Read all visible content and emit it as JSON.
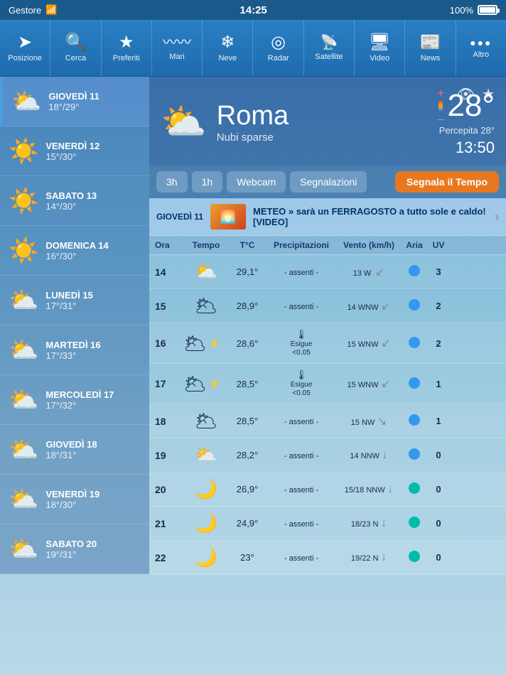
{
  "statusBar": {
    "carrier": "Gestore",
    "wifi": "📶",
    "time": "14:25",
    "battery": "100%"
  },
  "nav": {
    "items": [
      {
        "id": "posizione",
        "label": "Posizione",
        "icon": "➤"
      },
      {
        "id": "cerca",
        "label": "Cerca",
        "icon": "🔍"
      },
      {
        "id": "preferiti",
        "label": "Preferiti",
        "icon": "★"
      },
      {
        "id": "mari",
        "label": "Mari",
        "icon": "〰"
      },
      {
        "id": "neve",
        "label": "Neve",
        "icon": "❄"
      },
      {
        "id": "radar",
        "label": "Radar",
        "icon": "◎"
      },
      {
        "id": "satellite",
        "label": "Satellite",
        "icon": "📡"
      },
      {
        "id": "video",
        "label": "Video",
        "icon": "🖥"
      },
      {
        "id": "news",
        "label": "News",
        "icon": "📰"
      },
      {
        "id": "altro",
        "label": "Altro",
        "icon": "•••"
      }
    ]
  },
  "city": {
    "name": "Roma",
    "description": "Nubi sparse",
    "temperature": "28°",
    "percepita": "Percepita 28°",
    "time": "13:50",
    "icon": "⛅"
  },
  "tabs": [
    {
      "label": "3h",
      "id": "3h",
      "active": false
    },
    {
      "label": "1h",
      "id": "1h",
      "active": false
    },
    {
      "label": "Webcam",
      "id": "webcam",
      "active": false
    },
    {
      "label": "Segnalazioni",
      "id": "segnalazioni",
      "active": false
    },
    {
      "label": "Segnala il Tempo",
      "id": "segnala",
      "active": false,
      "orange": true
    }
  ],
  "newsBanner": {
    "title": "GIOVEDÌ 11",
    "text": "METEO » sarà un FERRAGOSTO a tutto sole e caldo! [VIDEO]",
    "emoji": "🌅"
  },
  "tableHeaders": {
    "ora": "Ora",
    "tempo": "Tempo",
    "temp": "T°C",
    "precipitazioni": "Precipitazioni",
    "vento": "Vento (km/h)",
    "aria": "Aria",
    "uv": "UV"
  },
  "days": [
    {
      "id": "gio11",
      "name": "GIOVEDÌ 11",
      "temps": "18°/29°",
      "icon": "⛅",
      "active": true
    },
    {
      "id": "ven12",
      "name": "VENERDÌ 12",
      "temps": "15°/30°",
      "icon": "☀️",
      "active": false
    },
    {
      "id": "sab13",
      "name": "SABATO 13",
      "temps": "14°/30°",
      "icon": "☀️",
      "active": false
    },
    {
      "id": "dom14",
      "name": "DOMENICA 14",
      "temps": "16°/30°",
      "icon": "☀️",
      "active": false
    },
    {
      "id": "lun15",
      "name": "LUNEDÌ 15",
      "temps": "17°/31°",
      "icon": "⛅",
      "active": false
    },
    {
      "id": "mar16",
      "name": "MARTEDÌ 16",
      "temps": "17°/33°",
      "icon": "⛅",
      "active": false
    },
    {
      "id": "mer17",
      "name": "MERCOLEDÌ 17",
      "temps": "17°/32°",
      "icon": "⛅",
      "active": false
    },
    {
      "id": "gio18",
      "name": "GIOVEDÌ 18",
      "temps": "18°/31°",
      "icon": "⛅",
      "active": false
    },
    {
      "id": "ven19",
      "name": "VENERDÌ 19",
      "temps": "18°/30°",
      "icon": "⛅",
      "active": false
    },
    {
      "id": "sab20",
      "name": "SABATO 20",
      "temps": "19°/31°",
      "icon": "⛅",
      "active": false
    }
  ],
  "weatherRows": [
    {
      "ora": "14",
      "icon": "⛅",
      "temp": "29,1°",
      "precip": "- assenti -",
      "vento": "13 W",
      "ariaBlue": true,
      "uv": "3"
    },
    {
      "ora": "15",
      "icon": "🌥",
      "temp": "28,9°",
      "precip": "- assenti -",
      "vento": "14 WNW",
      "ariaBlue": true,
      "uv": "2"
    },
    {
      "ora": "16",
      "icon": "⛈",
      "temp": "28,6°",
      "precipSmall": true,
      "precipLine1": "Esigue",
      "precipLine2": "<0.05",
      "vento": "15 WNW",
      "ariaBlue": true,
      "uv": "2"
    },
    {
      "ora": "17",
      "icon": "⛈",
      "temp": "28,5°",
      "precipSmall": true,
      "precipLine1": "Esigue",
      "precipLine2": "<0.05",
      "vento": "15 WNW",
      "ariaBlue": true,
      "uv": "1"
    },
    {
      "ora": "18",
      "icon": "🌥",
      "temp": "28,5°",
      "precip": "- assenti -",
      "vento": "15 NW",
      "ariaBlue": true,
      "uv": "1"
    },
    {
      "ora": "19",
      "icon": "⛅",
      "temp": "28,2°",
      "precip": "- assenti -",
      "vento": "14 NNW",
      "ariaBlue": true,
      "uv": "0"
    },
    {
      "ora": "20",
      "icon": "🌙",
      "temp": "26,9°",
      "precip": "- assenti -",
      "vento": "15/18 NNW",
      "ariaTeal": true,
      "uv": "0"
    },
    {
      "ora": "21",
      "icon": "🌙",
      "temp": "24,9°",
      "precip": "- assenti -",
      "vento": "18/23 N",
      "ariaTeal": true,
      "uv": "0"
    },
    {
      "ora": "22",
      "icon": "🌙",
      "temp": "23°",
      "precip": "- assenti -",
      "vento": "19/22 N",
      "ariaTeal": true,
      "uv": "0"
    }
  ]
}
